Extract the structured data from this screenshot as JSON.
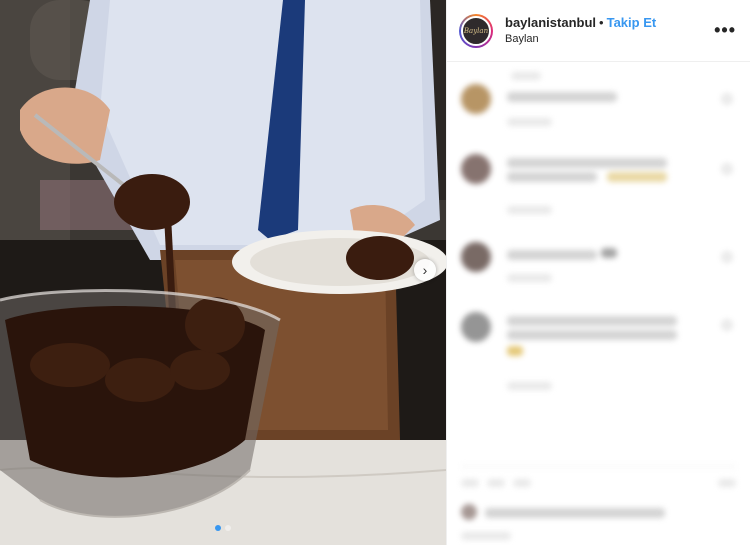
{
  "post": {
    "username": "baylanistanbul",
    "separator": "•",
    "follow_label": "Takip Et",
    "location": "Baylan",
    "more_icon": "more-horizontal-icon",
    "avatar_text": "Baylan"
  },
  "carousel": {
    "count": 2,
    "active_index": 0,
    "next_icon": "chevron-right-icon"
  },
  "colors": {
    "accent": "#3897f0",
    "text": "#262626",
    "border": "#efefef"
  }
}
